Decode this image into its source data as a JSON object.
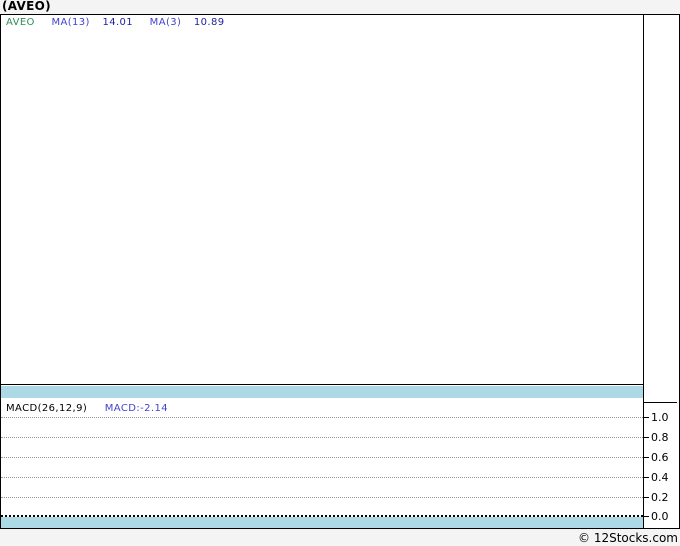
{
  "header": {
    "title": "(AVEO)"
  },
  "price_panel": {
    "legend": {
      "symbol": "AVEO",
      "ma13_label": "MA(13)",
      "ma13_value": "14.01",
      "ma3_label": "MA(3)",
      "ma3_value": "10.89"
    }
  },
  "macd_panel": {
    "indicator_label": "MACD(26,12,9)",
    "indicator_value": "MACD:-2.14",
    "axis_ticks": [
      "1.0",
      "0.8",
      "0.6",
      "0.4",
      "0.2",
      "0.0"
    ]
  },
  "footer": {
    "copyright": "© 12Stocks.com"
  },
  "colors": {
    "symbol_green": "#2E8B57",
    "indicator_label_blue": "#4242CC",
    "indicator_value_navy": "#1F1F9E",
    "separator_band_blue": "#ADD8E6",
    "gridline_gray": "#999999",
    "chrome_gray": "#F4F4F4"
  },
  "chart_data": [
    {
      "type": "line",
      "panel": "price",
      "title": "(AVEO)",
      "series": [
        {
          "name": "AVEO",
          "last_value": null,
          "values": []
        },
        {
          "name": "MA(13)",
          "last_value": 14.01,
          "values": []
        },
        {
          "name": "MA(3)",
          "last_value": 10.89,
          "values": []
        }
      ],
      "xlabel": "",
      "ylabel": "",
      "grid": false,
      "note": "panel rendered empty - no plotted points or axis labels visible"
    },
    {
      "type": "line",
      "panel": "MACD(26,12,9)",
      "last_value": -2.14,
      "series": [],
      "yticks": [
        0.0,
        0.2,
        0.4,
        0.6,
        0.8,
        1.0
      ],
      "ylim": [
        0.0,
        1.0
      ],
      "grid": true,
      "grid_style": "dotted",
      "zero_line": true,
      "legend_position": "top-left",
      "note": "panel rendered empty - only gridlines and right-axis ticks visible"
    }
  ]
}
